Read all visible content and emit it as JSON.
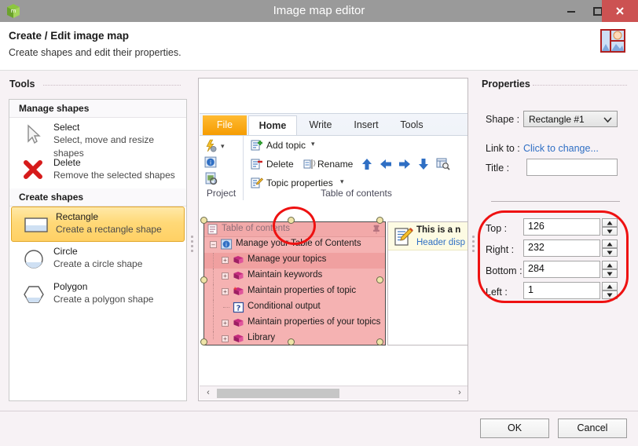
{
  "window": {
    "title": "Image map editor",
    "app_icon": "green-cube-icon",
    "minimize_label": "Minimize",
    "maximize_label": "Maximize",
    "close_label": "Close"
  },
  "header": {
    "title": "Create / Edit image map",
    "subtitle": "Create shapes and edit their properties.",
    "icon": "image-map-icon"
  },
  "tools": {
    "heading": "Tools",
    "groups": [
      {
        "name": "Manage shapes",
        "items": [
          {
            "title": "Select",
            "desc": "Select, move and resize shapes",
            "icon": "cursor-arrow-icon",
            "selected": false
          },
          {
            "title": "Delete",
            "desc": "Remove the selected shapes",
            "icon": "red-x-icon",
            "selected": false
          }
        ]
      },
      {
        "name": "Create shapes",
        "items": [
          {
            "title": "Rectangle",
            "desc": "Create a rectangle shape",
            "icon": "rectangle-shape-icon",
            "selected": true
          },
          {
            "title": "Circle",
            "desc": "Create a circle shape",
            "icon": "circle-shape-icon",
            "selected": false
          },
          {
            "title": "Polygon",
            "desc": "Create a polygon shape",
            "icon": "polygon-shape-icon",
            "selected": false
          }
        ]
      }
    ]
  },
  "canvas": {
    "ribbon": {
      "tabs": [
        {
          "label": "File",
          "active": false,
          "style": "file"
        },
        {
          "label": "Home",
          "active": true,
          "style": "normal"
        },
        {
          "label": "Write",
          "active": false,
          "style": "normal"
        },
        {
          "label": "Insert",
          "active": false,
          "style": "normal"
        },
        {
          "label": "Tools",
          "active": false,
          "style": "normal"
        }
      ],
      "groups": [
        {
          "label": "Project"
        },
        {
          "label": "Table of contents"
        }
      ],
      "commands": [
        {
          "label": "Add topic",
          "icon": "add-topic-icon",
          "dropdown": true
        },
        {
          "label": "Delete",
          "icon": "delete-topic-icon",
          "dropdown": false
        },
        {
          "label": "Rename",
          "icon": "rename-topic-icon",
          "dropdown": false
        },
        {
          "label": "Topic properties",
          "icon": "topic-properties-icon",
          "dropdown": true
        }
      ],
      "arrow_buttons": [
        "move-up-icon",
        "move-left-icon",
        "move-right-icon",
        "move-down-icon",
        "find-topic-icon"
      ],
      "project_icons": [
        "quick-actions-icon",
        "project-info-icon",
        "project-settings-icon"
      ]
    },
    "toc_pane": {
      "title": "Table of contents",
      "pin_icon": "pin-icon",
      "nodes": [
        {
          "label": "Manage your Table of Contents",
          "depth": 0,
          "expander": "minus",
          "icon": "toc-root-icon",
          "selected": false
        },
        {
          "label": "Manage your topics",
          "depth": 1,
          "expander": "plus",
          "icon": "book-icon",
          "selected": true
        },
        {
          "label": "Maintain keywords",
          "depth": 1,
          "expander": "plus",
          "icon": "book-icon",
          "selected": false
        },
        {
          "label": "Maintain properties of topic",
          "depth": 1,
          "expander": "plus",
          "icon": "book-star-icon",
          "selected": false
        },
        {
          "label": "Conditional output",
          "depth": 1,
          "expander": "none",
          "icon": "question-topic-icon",
          "selected": false
        },
        {
          "label": "Maintain properties of your topics",
          "depth": 1,
          "expander": "plus",
          "icon": "book-icon",
          "selected": false
        },
        {
          "label": "Library",
          "depth": 1,
          "expander": "plus",
          "icon": "book-icon",
          "selected": false
        }
      ]
    },
    "content_pane": {
      "icon": "document-edit-icon",
      "line1": "This is a n",
      "line2": "Header disp"
    },
    "scrollbar": {
      "left_arrow": "‹",
      "right_arrow": "›"
    },
    "annotation_ellipse": "red-highlight-ellipse"
  },
  "properties": {
    "heading": "Properties",
    "shape_label": "Shape :",
    "shape_value": "Rectangle #1",
    "shape_options": [
      "Rectangle #1"
    ],
    "linkto_label": "Link to :",
    "linkto_value": "Click to change...",
    "title_label": "Title :",
    "title_value": "",
    "title_placeholder": "",
    "bounds": [
      {
        "label": "Top :",
        "value": "126"
      },
      {
        "label": "Right :",
        "value": "232"
      },
      {
        "label": "Bottom :",
        "value": "284"
      },
      {
        "label": "Left :",
        "value": "1"
      }
    ],
    "annotation_ellipse": "red-highlight-rounded-rect"
  },
  "footer": {
    "ok_label": "OK",
    "cancel_label": "Cancel"
  },
  "colors": {
    "titlebar": "#9a9a9a",
    "close_button": "#cc5252",
    "accent_orange": "#f59b00",
    "selection_pink": "#f5b2b2",
    "annotation_red": "#ee1111",
    "link_blue": "#2f6fc4",
    "highlight_yellow": "#ffd978"
  }
}
